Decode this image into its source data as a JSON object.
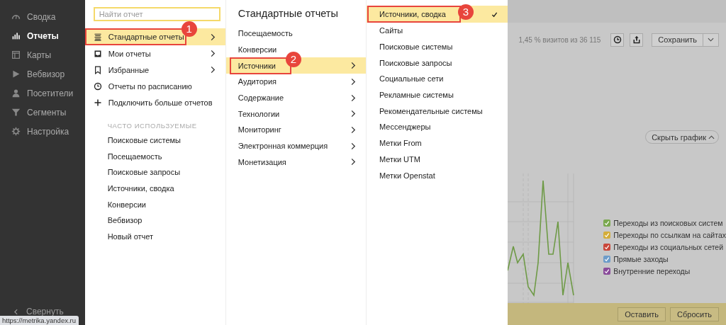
{
  "sidebar": {
    "items": [
      {
        "label": "Сводка",
        "selected": false
      },
      {
        "label": "Отчеты",
        "selected": true
      },
      {
        "label": "Карты",
        "selected": false
      },
      {
        "label": "Вебвизор",
        "selected": false
      },
      {
        "label": "Посетители",
        "selected": false
      },
      {
        "label": "Сегменты",
        "selected": false
      },
      {
        "label": "Настройка",
        "selected": false
      }
    ],
    "collapse": "Свернуть"
  },
  "status_url": "https://metrika.yandex.ru",
  "menu": {
    "search": {
      "placeholder": "Найти отчет"
    },
    "items": [
      {
        "label": "Стандартные отчеты",
        "selected": true,
        "submenu": true,
        "step": "1"
      },
      {
        "label": "Мои отчеты",
        "selected": false,
        "submenu": true
      },
      {
        "label": "Избранные",
        "selected": false,
        "submenu": true
      },
      {
        "label": "Отчеты по расписанию",
        "selected": false,
        "submenu": false
      },
      {
        "label": "Подключить больше отчетов",
        "selected": false,
        "submenu": false
      }
    ],
    "frequent_heading": "ЧАСТО ИСПОЛЬЗУЕМЫЕ",
    "frequent": [
      "Поисковые системы",
      "Посещаемость",
      "Поисковые запросы",
      "Источники, сводка",
      "Конверсии",
      "Вебвизор",
      "Новый отчет"
    ]
  },
  "submenu": {
    "title": "Стандартные отчеты",
    "items": [
      {
        "label": "Посещаемость",
        "selected": false,
        "submenu": false
      },
      {
        "label": "Конверсии",
        "selected": false,
        "submenu": false
      },
      {
        "label": "Источники",
        "selected": true,
        "submenu": true,
        "step": "2"
      },
      {
        "label": "Аудитория",
        "selected": false,
        "submenu": true
      },
      {
        "label": "Содержание",
        "selected": false,
        "submenu": true
      },
      {
        "label": "Технологии",
        "selected": false,
        "submenu": true
      },
      {
        "label": "Мониторинг",
        "selected": false,
        "submenu": true
      },
      {
        "label": "Электронная коммерция",
        "selected": false,
        "submenu": true
      },
      {
        "label": "Монетизация",
        "selected": false,
        "submenu": true
      }
    ]
  },
  "sources": {
    "items": [
      {
        "label": "Источники, сводка",
        "selected": true,
        "step": "3"
      },
      {
        "label": "Сайты",
        "selected": false
      },
      {
        "label": "Поисковые системы",
        "selected": false
      },
      {
        "label": "Поисковые запросы",
        "selected": false
      },
      {
        "label": "Социальные сети",
        "selected": false
      },
      {
        "label": "Рекламные системы",
        "selected": false
      },
      {
        "label": "Рекомендательные системы",
        "selected": false
      },
      {
        "label": "Мессенджеры",
        "selected": false
      },
      {
        "label": "Метки From",
        "selected": false
      },
      {
        "label": "Метки UTM",
        "selected": false
      },
      {
        "label": "Метки Openstat",
        "selected": false
      }
    ]
  },
  "report": {
    "visits": "1,45 % визитов из 36 115",
    "save": "Сохранить",
    "hide_chart": "Скрыть график",
    "legend": [
      {
        "label": "Переходы из поисковых систем",
        "color": "#7aa84f",
        "checked": true
      },
      {
        "label": "Переходы по ссылкам на сайтах",
        "color": "#d4ad3a",
        "checked": true
      },
      {
        "label": "Переходы из социальных сетей",
        "color": "#c9473a",
        "checked": true
      },
      {
        "label": "Прямые заходы",
        "color": "#6d9cc9",
        "checked": true
      },
      {
        "label": "Внутренние переходы",
        "color": "#8a4c9a",
        "checked": true
      }
    ],
    "actions": [
      "Оставить",
      "Сбросить"
    ]
  }
}
